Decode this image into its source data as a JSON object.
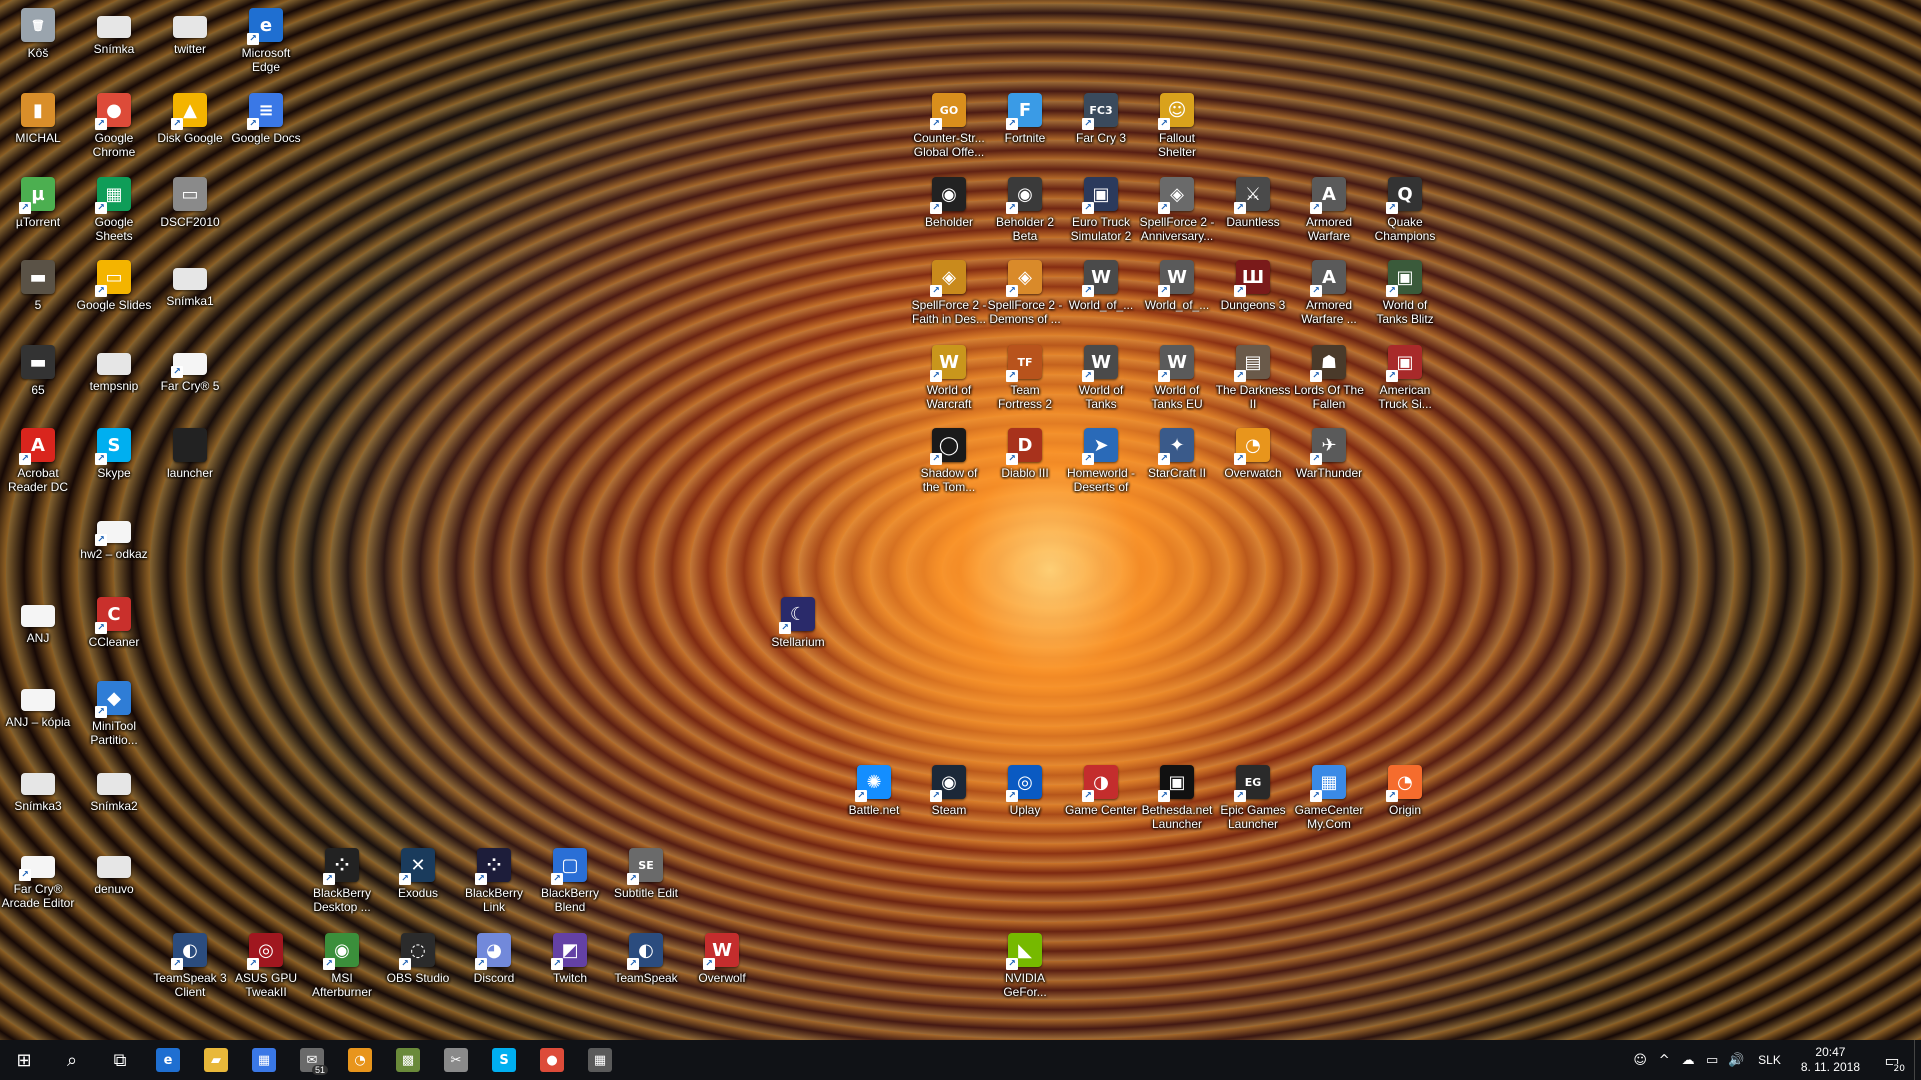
{
  "desktop_icons": [
    {
      "label": "Kôš",
      "glyph": "🗑",
      "color": "#9aa4ad",
      "sc": false
    },
    {
      "label": "Snímka",
      "glyph": "",
      "color": "#e6e6e6",
      "sc": false
    },
    {
      "label": "twitter",
      "glyph": "",
      "color": "#e6e6e6",
      "sc": false
    },
    {
      "label": "Microsoft Edge",
      "glyph": "e",
      "color": "#1f6fd1",
      "sc": true
    },
    {
      "label": "MICHAL",
      "glyph": "▮",
      "color": "#d98e2a",
      "sc": false
    },
    {
      "label": "Google Chrome",
      "glyph": "●",
      "color": "#dd4b39",
      "sc": true
    },
    {
      "label": "Disk Google",
      "glyph": "▲",
      "color": "#f4b400",
      "sc": true
    },
    {
      "label": "Google Docs",
      "glyph": "≡",
      "color": "#3a78e6",
      "sc": true
    },
    {
      "label": "µTorrent",
      "glyph": "µ",
      "color": "#4caf50",
      "sc": true
    },
    {
      "label": "Google Sheets",
      "glyph": "▦",
      "color": "#0f9d58",
      "sc": true
    },
    {
      "label": "DSCF2010",
      "glyph": "▭",
      "color": "#8a8a8a",
      "sc": false
    },
    {
      "label": "5",
      "glyph": "▬",
      "color": "#5a5246",
      "sc": false
    },
    {
      "label": "Google Slides",
      "glyph": "▭",
      "color": "#f4b400",
      "sc": true
    },
    {
      "label": "Snímka1",
      "glyph": "",
      "color": "#e6e6e6",
      "sc": false
    },
    {
      "label": "65",
      "glyph": "▬",
      "color": "#333",
      "sc": false
    },
    {
      "label": "tempsnip",
      "glyph": "",
      "color": "#e6e6e6",
      "sc": false
    },
    {
      "label": "Far Cry® 5",
      "glyph": "",
      "color": "#f5f5f5",
      "sc": true
    },
    {
      "label": "Acrobat Reader DC",
      "glyph": "A",
      "color": "#d9251d",
      "sc": true
    },
    {
      "label": "Skype",
      "glyph": "S",
      "color": "#00aff0",
      "sc": true
    },
    {
      "label": "launcher",
      "glyph": "",
      "color": "#222",
      "sc": false
    },
    {
      "label": "hw2 – odkaz",
      "glyph": "",
      "color": "#f5f5f5",
      "sc": true
    },
    {
      "label": "ANJ",
      "glyph": "",
      "color": "#f5f5f5",
      "sc": false
    },
    {
      "label": "CCleaner",
      "glyph": "C",
      "color": "#c9302c",
      "sc": true
    },
    {
      "label": "ANJ – kópia",
      "glyph": "",
      "color": "#f5f5f5",
      "sc": false
    },
    {
      "label": "MiniTool Partitio...",
      "glyph": "◆",
      "color": "#2f7dd6",
      "sc": true
    },
    {
      "label": "Snímka3",
      "glyph": "",
      "color": "#e6e6e6",
      "sc": false
    },
    {
      "label": "Snímka2",
      "glyph": "",
      "color": "#e6e6e6",
      "sc": false
    },
    {
      "label": "Far Cry® Arcade Editor",
      "glyph": "",
      "color": "#f5f5f5",
      "sc": true
    },
    {
      "label": "denuvo",
      "glyph": "",
      "color": "#e6e6e6",
      "sc": false
    },
    {
      "label": "BlackBerry Desktop ...",
      "glyph": "⁘",
      "color": "#222",
      "sc": true
    },
    {
      "label": "Exodus",
      "glyph": "✕",
      "color": "#1a3b5c",
      "sc": true
    },
    {
      "label": "BlackBerry Link",
      "glyph": "⁘",
      "color": "#1d1d3a",
      "sc": true
    },
    {
      "label": "BlackBerry Blend",
      "glyph": "▢",
      "color": "#2a6fd6",
      "sc": true
    },
    {
      "label": "Subtitle Edit",
      "glyph": "SE",
      "color": "#6a6a6a",
      "sc": true
    },
    {
      "label": "TeamSpeak 3 Client",
      "glyph": "◐",
      "color": "#2b4c7e",
      "sc": true
    },
    {
      "label": "ASUS GPU TweakII",
      "glyph": "◎",
      "color": "#a0171f",
      "sc": true
    },
    {
      "label": "MSI Afterburner",
      "glyph": "◉",
      "color": "#3b8f3b",
      "sc": true
    },
    {
      "label": "OBS Studio",
      "glyph": "◌",
      "color": "#2b2b2b",
      "sc": true
    },
    {
      "label": "Discord",
      "glyph": "◕",
      "color": "#7289da",
      "sc": true
    },
    {
      "label": "Twitch",
      "glyph": "◩",
      "color": "#6441a5",
      "sc": true
    },
    {
      "label": "TeamSpeak",
      "glyph": "◐",
      "color": "#2b4c7e",
      "sc": true
    },
    {
      "label": "Overwolf",
      "glyph": "W",
      "color": "#c42d2d",
      "sc": true
    },
    {
      "label": "Counter-Str... Global Offe...",
      "glyph": "GO",
      "color": "#d98f1c",
      "sc": true
    },
    {
      "label": "Fortnite",
      "glyph": "F",
      "color": "#3a9be6",
      "sc": true
    },
    {
      "label": "Far Cry 3",
      "glyph": "FC3",
      "color": "#3a4a5c",
      "sc": true
    },
    {
      "label": "Fallout Shelter",
      "glyph": "☺",
      "color": "#d9a21c",
      "sc": true
    },
    {
      "label": "Beholder",
      "glyph": "◉",
      "color": "#222",
      "sc": true
    },
    {
      "label": "Beholder 2 Beta",
      "glyph": "◉",
      "color": "#3a3a3a",
      "sc": true
    },
    {
      "label": "Euro Truck Simulator 2",
      "glyph": "▣",
      "color": "#2b3a5c",
      "sc": true
    },
    {
      "label": "SpellForce 2 - Anniversary...",
      "glyph": "◈",
      "color": "#6a6a6a",
      "sc": true
    },
    {
      "label": "Dauntless",
      "glyph": "⚔",
      "color": "#4a4a4a",
      "sc": true
    },
    {
      "label": "Armored Warfare",
      "glyph": "A",
      "color": "#5a5a5a",
      "sc": true
    },
    {
      "label": "Quake Champions",
      "glyph": "Q",
      "color": "#333",
      "sc": true
    },
    {
      "label": "SpellForce 2 - Faith in Des...",
      "glyph": "◈",
      "color": "#c98a1c",
      "sc": true
    },
    {
      "label": "SpellForce 2 - Demons of ...",
      "glyph": "◈",
      "color": "#d98a2a",
      "sc": true
    },
    {
      "label": "World_of_...",
      "glyph": "W",
      "color": "#4a4a4a",
      "sc": true
    },
    {
      "label": "World_of_...",
      "glyph": "W",
      "color": "#5a5a5a",
      "sc": true
    },
    {
      "label": "Dungeons 3",
      "glyph": "Ш",
      "color": "#7a1a1a",
      "sc": true
    },
    {
      "label": "Armored Warfare ...",
      "glyph": "A",
      "color": "#5a5a5a",
      "sc": true
    },
    {
      "label": "World of Tanks Blitz",
      "glyph": "▣",
      "color": "#3a5a3a",
      "sc": true
    },
    {
      "label": "World of Warcraft",
      "glyph": "W",
      "color": "#c9961c",
      "sc": true
    },
    {
      "label": "Team Fortress 2",
      "glyph": "TF",
      "color": "#b8531c",
      "sc": true
    },
    {
      "label": "World of Tanks",
      "glyph": "W",
      "color": "#4a4a4a",
      "sc": true
    },
    {
      "label": "World of Tanks EU",
      "glyph": "W",
      "color": "#5a5a5a",
      "sc": true
    },
    {
      "label": "The Darkness II",
      "glyph": "▤",
      "color": "#6a5a4a",
      "sc": true
    },
    {
      "label": "Lords Of The Fallen",
      "glyph": "☗",
      "color": "#4a3a2a",
      "sc": true
    },
    {
      "label": "American Truck Si...",
      "glyph": "▣",
      "color": "#a82a2a",
      "sc": true
    },
    {
      "label": "Shadow of the Tom...",
      "glyph": "◯",
      "color": "#1a1a1a",
      "sc": true
    },
    {
      "label": "Diablo III",
      "glyph": "D",
      "color": "#a8321c",
      "sc": true
    },
    {
      "label": "Homeworld - Deserts of K...",
      "glyph": "➤",
      "color": "#2a6ab8",
      "sc": true
    },
    {
      "label": "StarCraft II",
      "glyph": "✦",
      "color": "#3a5a8a",
      "sc": true
    },
    {
      "label": "Overwatch",
      "glyph": "◔",
      "color": "#e8951c",
      "sc": true
    },
    {
      "label": "WarThunder",
      "glyph": "✈",
      "color": "#5a5a5a",
      "sc": true
    },
    {
      "label": "Stellarium",
      "glyph": "☾",
      "color": "#2a2a6a",
      "sc": true
    },
    {
      "label": "Battle.net",
      "glyph": "✺",
      "color": "#148eff",
      "sc": true
    },
    {
      "label": "Steam",
      "glyph": "◉",
      "color": "#1b2838",
      "sc": true
    },
    {
      "label": "Uplay",
      "glyph": "◎",
      "color": "#0a5ac2",
      "sc": true
    },
    {
      "label": "Game Center",
      "glyph": "◑",
      "color": "#c42d2d",
      "sc": true
    },
    {
      "label": "Bethesda.net Launcher",
      "glyph": "▣",
      "color": "#111",
      "sc": true
    },
    {
      "label": "Epic Games Launcher",
      "glyph": "EG",
      "color": "#2a2a2a",
      "sc": true
    },
    {
      "label": "GameCenter My.Com",
      "glyph": "▦",
      "color": "#3a8ae6",
      "sc": true
    },
    {
      "label": "Origin",
      "glyph": "◔",
      "color": "#f56c2d",
      "sc": true
    },
    {
      "label": "NVIDIA GeFor...",
      "glyph": "◣",
      "color": "#76b900",
      "sc": true
    }
  ],
  "taskbar": {
    "start": "⊞",
    "search": "⌕",
    "task_view": "⧉",
    "apps": [
      {
        "name": "microsoft-edge",
        "glyph": "e",
        "color": "#1f6fd1",
        "badge": ""
      },
      {
        "name": "file-explorer",
        "glyph": "▰",
        "color": "#e8b83a",
        "badge": ""
      },
      {
        "name": "microsoft-store",
        "glyph": "▦",
        "color": "#3a78e6",
        "badge": ""
      },
      {
        "name": "mail",
        "glyph": "✉",
        "color": "#6a6a6a",
        "badge": "51"
      },
      {
        "name": "overwatch",
        "glyph": "◔",
        "color": "#e8951c",
        "badge": ""
      },
      {
        "name": "minecraft",
        "glyph": "▩",
        "color": "#6a8a3a",
        "badge": ""
      },
      {
        "name": "snipping-tool",
        "glyph": "✂",
        "color": "#8a8a8a",
        "badge": ""
      },
      {
        "name": "skype",
        "glyph": "S",
        "color": "#00aff0",
        "badge": ""
      },
      {
        "name": "google-chrome",
        "glyph": "●",
        "color": "#dd4b39",
        "badge": ""
      },
      {
        "name": "calculator",
        "glyph": "▦",
        "color": "#5a5a5a",
        "badge": ""
      }
    ]
  },
  "tray": {
    "people": "☺",
    "chevron": "^",
    "cloud": "☁",
    "network": "▭",
    "volume": "🔊",
    "language": "SLK",
    "time": "20:47",
    "date": "8. 11. 2018",
    "notifications": "20"
  }
}
